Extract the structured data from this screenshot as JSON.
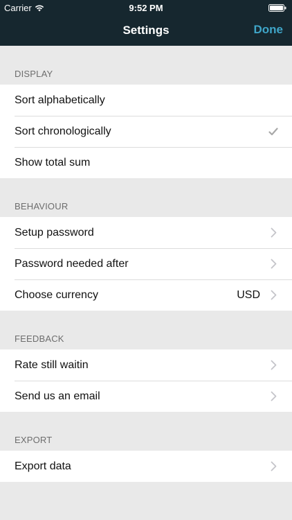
{
  "status_bar": {
    "carrier": "Carrier",
    "time": "9:52 PM"
  },
  "nav": {
    "title": "Settings",
    "done_label": "Done"
  },
  "colors": {
    "nav_background": "#16272f",
    "accent": "#3fa5c8",
    "page_background": "#e9e9e9"
  },
  "sections": [
    {
      "header": "DISPLAY",
      "rows": [
        {
          "label": "Sort alphabetically",
          "accessory": "none"
        },
        {
          "label": "Sort chronologically",
          "accessory": "checkmark-icon"
        },
        {
          "label": "Show total sum",
          "accessory": "none"
        }
      ]
    },
    {
      "header": "BEHAVIOUR",
      "rows": [
        {
          "label": "Setup password",
          "accessory": "chevron-right-icon"
        },
        {
          "label": "Password needed after",
          "accessory": "chevron-right-icon"
        },
        {
          "label": "Choose currency",
          "value": "USD",
          "accessory": "chevron-right-icon"
        }
      ]
    },
    {
      "header": "FEEDBACK",
      "rows": [
        {
          "label": "Rate still waitin",
          "accessory": "chevron-right-icon"
        },
        {
          "label": "Send us an email",
          "accessory": "chevron-right-icon"
        }
      ]
    },
    {
      "header": "EXPORT",
      "rows": [
        {
          "label": "Export data",
          "accessory": "chevron-right-icon"
        }
      ]
    }
  ]
}
